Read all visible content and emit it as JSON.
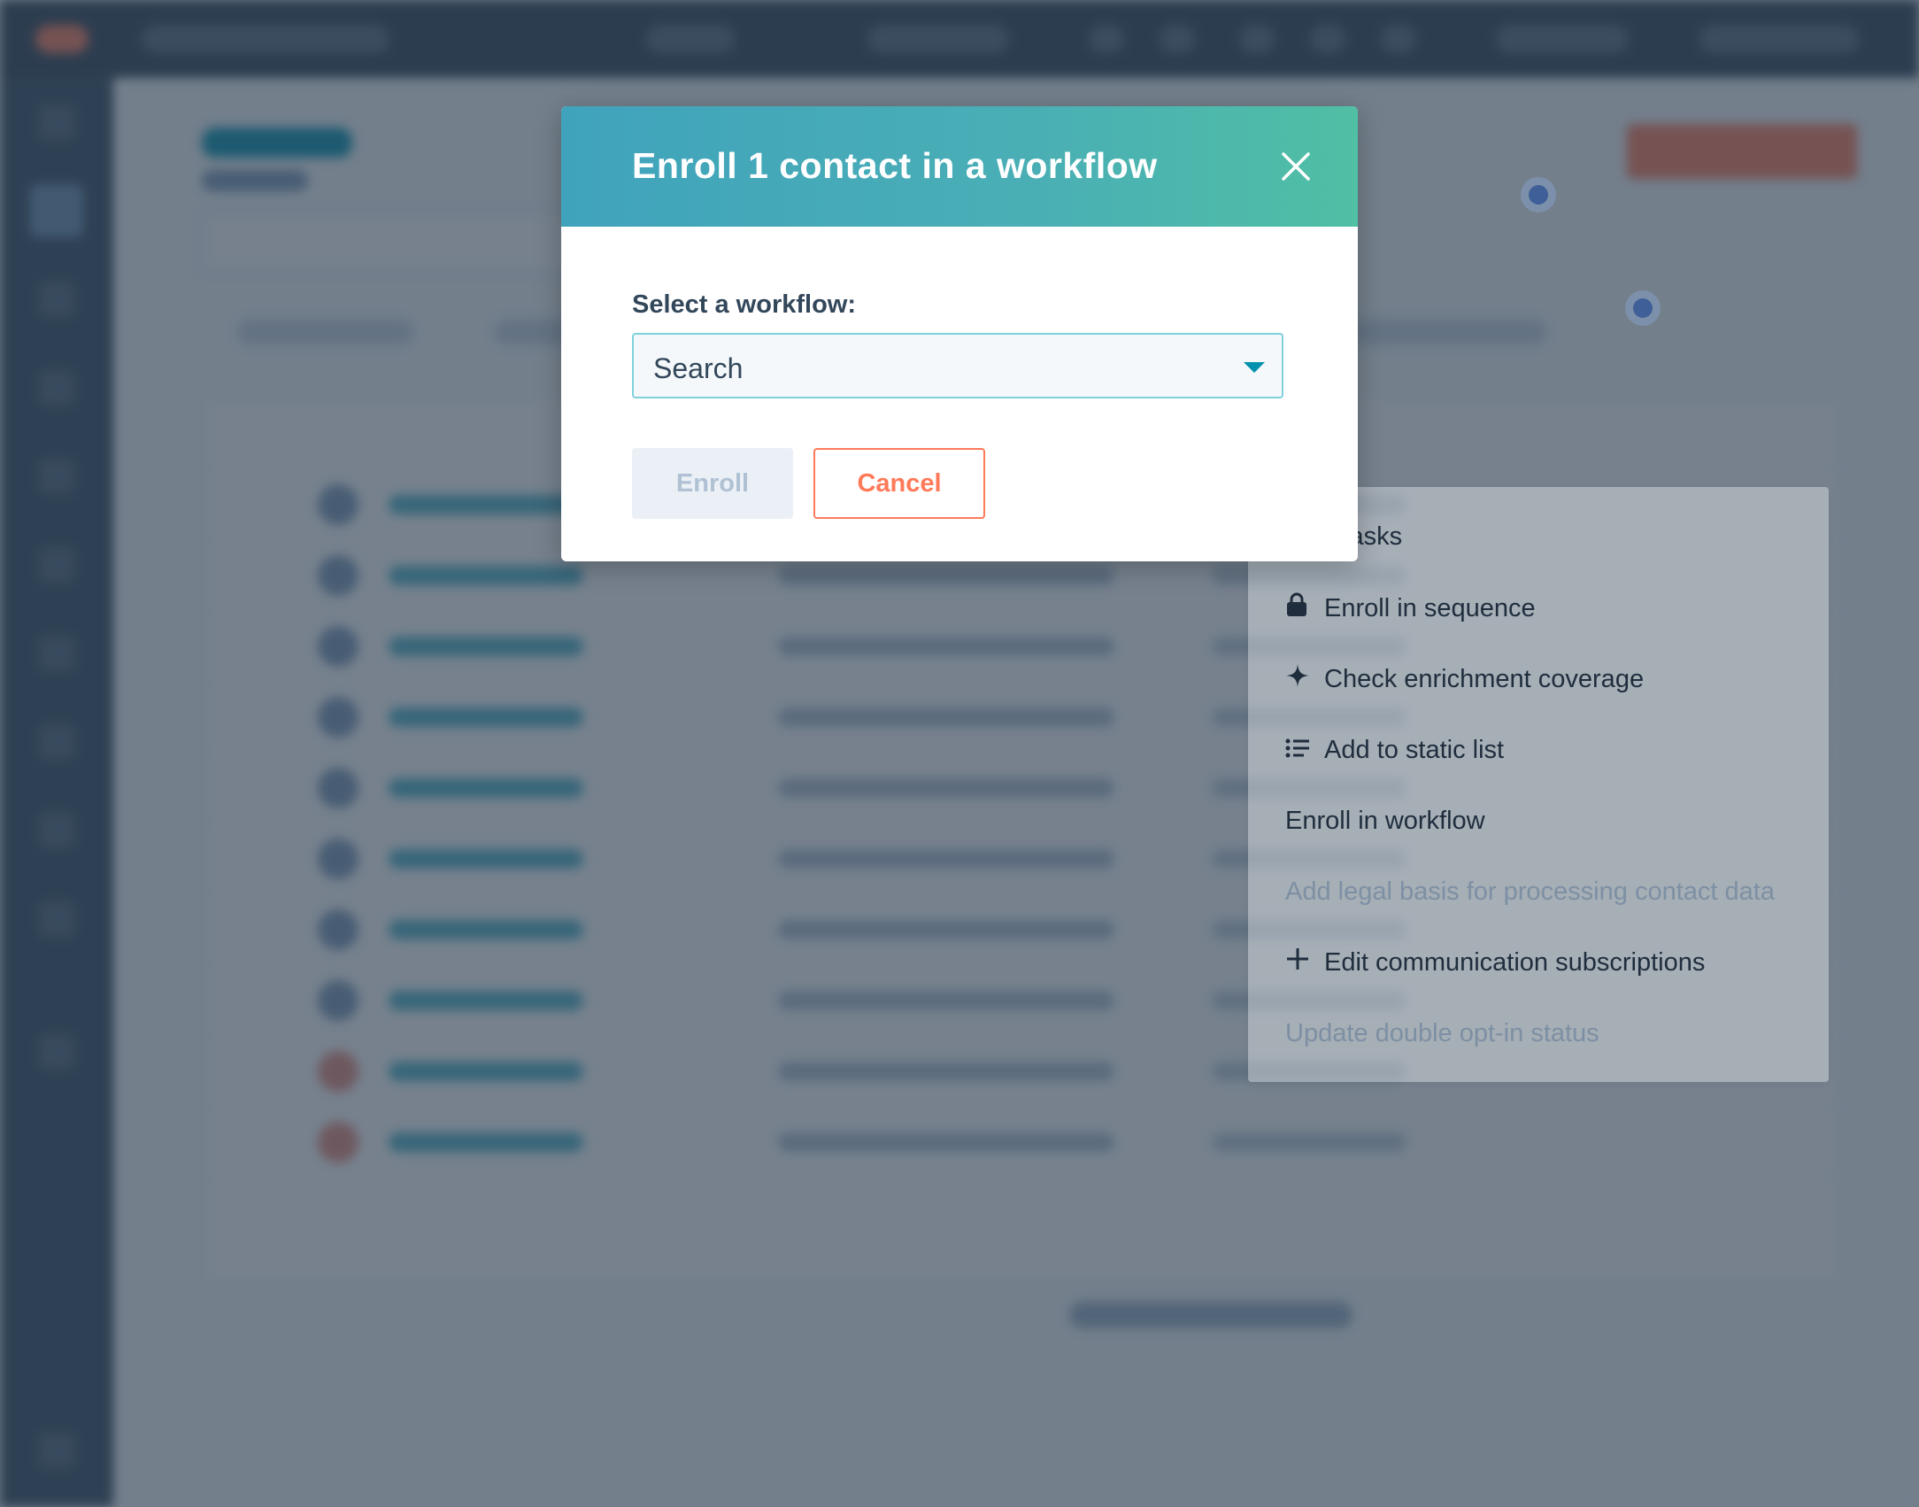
{
  "modal": {
    "title": "Enroll 1 contact in a workflow",
    "field_label": "Select a workflow:",
    "select_placeholder": "Search",
    "enroll_label": "Enroll",
    "cancel_label": "Cancel"
  },
  "menu": {
    "items": [
      {
        "label": "eate tasks",
        "icon": "none"
      },
      {
        "label": "Enroll in sequence",
        "icon": "lock-icon"
      },
      {
        "label": "Check enrichment coverage",
        "icon": "sparkle-icon"
      },
      {
        "label": "Add to static list",
        "icon": "list-icon"
      },
      {
        "label": "Enroll in workflow",
        "icon": "none"
      },
      {
        "label": "Add legal basis for processing contact data",
        "icon": "none",
        "disabled": true
      },
      {
        "label": "Edit communication subscriptions",
        "icon": "plus-icon"
      },
      {
        "label": "Update double opt-in status",
        "icon": "none",
        "disabled": true
      }
    ]
  },
  "colors": {
    "header_start": "#40a3bc",
    "header_end": "#50bfa4",
    "cancel_accent": "#ff7a59",
    "select_border": "#7fd1de"
  }
}
